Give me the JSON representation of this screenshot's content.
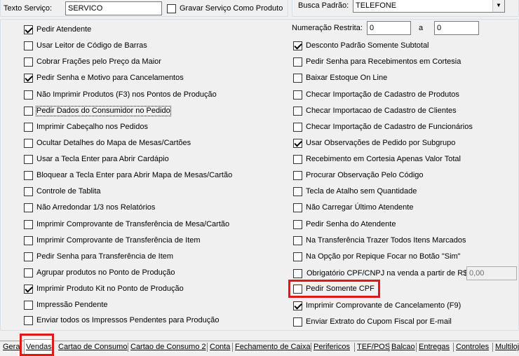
{
  "top": {
    "texto_servico_label": "Texto Serviço:",
    "texto_servico_value": "SERVICO",
    "gravar_label": "Gravar Serviço Como Produto",
    "busca_label": "Busca Padrão:",
    "busca_value": "TELEFONE"
  },
  "left_options": [
    {
      "label": "Pedir Atendente",
      "checked": true
    },
    {
      "label": "Usar Leitor de Código de Barras",
      "checked": false
    },
    {
      "label": "Cobrar Frações pelo Preço da Maior",
      "checked": false
    },
    {
      "label": "Pedir Senha e Motivo para Cancelamentos",
      "checked": true
    },
    {
      "label": "Não Imprimir Produtos (F3) nos Pontos de Produção",
      "checked": false
    },
    {
      "label": "Pedir Dados do Consumidor no Pedido",
      "checked": false
    },
    {
      "label": "Imprimir Cabeçalho nos Pedidos",
      "checked": false
    },
    {
      "label": "Ocultar Detalhes do Mapa de Mesas/Cartões",
      "checked": false
    },
    {
      "label": "Usar a Tecla Enter para Abrir Cardápio",
      "checked": false
    },
    {
      "label": "Bloquear a Tecla Enter para Abrir Mapa de Mesas/Cartão",
      "checked": false
    },
    {
      "label": "Controle de Tablita",
      "checked": false
    },
    {
      "label": "Não Arredondar 1/3 nos Relatórios",
      "checked": false
    },
    {
      "label": "Imprimir Comprovante de Transferência de Mesa/Cartão",
      "checked": false
    },
    {
      "label": "Imprimir Comprovante de Transferência de Item",
      "checked": false
    },
    {
      "label": "Pedir Senha para Transferência de Item",
      "checked": false
    },
    {
      "label": "Agrupar produtos no Ponto de Produção",
      "checked": false
    },
    {
      "label": "Imprimir Produto Kit no Ponto de Produção",
      "checked": true
    },
    {
      "label": "Impressão Pendente",
      "checked": false
    },
    {
      "label": "Enviar todos os Impressos Pendentes para Produção",
      "checked": false
    }
  ],
  "right": {
    "numeracao_label": "Numeração Restrita:",
    "numeracao_from": "0",
    "numeracao_a": "a",
    "numeracao_to": "0",
    "options": [
      {
        "label": "Desconto Padrão Somente Subtotal",
        "checked": true
      },
      {
        "label": "Pedir Senha para Recebimentos em Cortesia",
        "checked": false
      },
      {
        "label": "Baixar Estoque On Line",
        "checked": false
      },
      {
        "label": "Checar Importação de Cadastro de Produtos",
        "checked": false
      },
      {
        "label": "Checar Importacao de Cadastro de Clientes",
        "checked": false
      },
      {
        "label": "Checar Importação de Cadastro de Funcionários",
        "checked": false
      },
      {
        "label": "Usar Observações de Pedido por Subgrupo",
        "checked": true
      },
      {
        "label": "Recebimento em Cortesia Apenas Valor Total",
        "checked": false
      },
      {
        "label": "Procurar Observação Pelo Código",
        "checked": false
      },
      {
        "label": "Tecla de Atalho sem Quantidade",
        "checked": false
      },
      {
        "label": "Não Carregar Último Atendente",
        "checked": false
      },
      {
        "label": "Pedir Senha do Atendente",
        "checked": false
      },
      {
        "label": "Na Transferência Trazer Todos Itens Marcados",
        "checked": false
      },
      {
        "label": "Na Opção por Repique Focar no Botão \"Sim\"",
        "checked": false
      }
    ],
    "cpf_label": "Obrigatório CPF/CNPJ na venda a partir de R$",
    "cpf_value": "0,00",
    "pedir_cpf_label": "Pedir Somente CPF",
    "imprimir_cancel_label": "Imprimir Comprovante de Cancelamento (F9)",
    "enviar_extrato_label": "Enviar Extrato do Cupom Fiscal por E-mail"
  },
  "tabs": [
    "Geral",
    "Vendas",
    "Cartao de Consumo",
    "Cartao de Consumo 2",
    "Conta",
    "Fechamento de Caixa",
    "Perifericos",
    "TEF/POS",
    "Balcao",
    "Entregas",
    "Controles",
    "Multiloja"
  ],
  "active_tab": "Vendas",
  "colors": {
    "highlight": "#e01818",
    "background": "#f0f0f0"
  }
}
